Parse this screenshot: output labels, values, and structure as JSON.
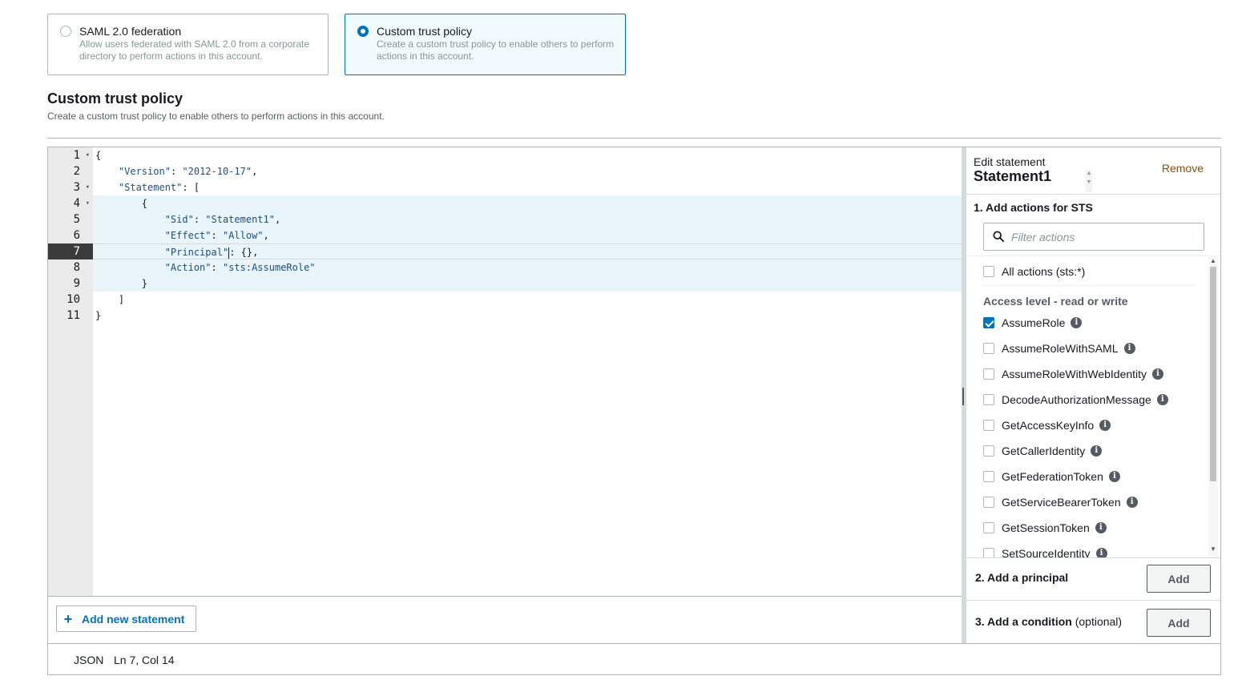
{
  "trust_options": [
    {
      "title": "SAML 2.0 federation",
      "desc": "Allow users federated with SAML 2.0 from a corporate directory to perform actions in this account.",
      "selected": false
    },
    {
      "title": "Custom trust policy",
      "desc": "Create a custom trust policy to enable others to perform actions in this account.",
      "selected": true
    }
  ],
  "section": {
    "title": "Custom trust policy",
    "desc": "Create a custom trust policy to enable others to perform actions in this account."
  },
  "editor": {
    "line_numbers": [
      "1",
      "2",
      "3",
      "4",
      "5",
      "6",
      "7",
      "8",
      "9",
      "10",
      "11"
    ],
    "active_line": 7,
    "lines": [
      "{",
      "    \"Version\": \"2012-10-17\",",
      "    \"Statement\": [",
      "        {",
      "            \"Sid\": \"Statement1\",",
      "            \"Effect\": \"Allow\",",
      "            \"Principal\": {},",
      "            \"Action\": \"sts:AssumeRole\"",
      "        }",
      "    ]",
      "}"
    ],
    "add_statement_label": "Add new statement"
  },
  "panel": {
    "edit_label": "Edit statement",
    "statement_name": "Statement1",
    "remove_label": "Remove",
    "step1_title": "1. Add actions for STS",
    "filter_placeholder": "Filter actions",
    "all_actions_label": "All actions (sts:*)",
    "access_level_label": "Access level - read or write",
    "actions": [
      {
        "name": "AssumeRole",
        "checked": true
      },
      {
        "name": "AssumeRoleWithSAML",
        "checked": false
      },
      {
        "name": "AssumeRoleWithWebIdentity",
        "checked": false
      },
      {
        "name": "DecodeAuthorizationMessage",
        "checked": false
      },
      {
        "name": "GetAccessKeyInfo",
        "checked": false
      },
      {
        "name": "GetCallerIdentity",
        "checked": false
      },
      {
        "name": "GetFederationToken",
        "checked": false
      },
      {
        "name": "GetServiceBearerToken",
        "checked": false
      },
      {
        "name": "GetSessionToken",
        "checked": false
      },
      {
        "name": "SetSourceIdentity",
        "checked": false
      }
    ],
    "step2_title": "2. Add a principal",
    "step2_button": "Add",
    "step3_title": "3. Add a condition",
    "step3_optional": "(optional)",
    "step3_button": "Add"
  },
  "status_bar": {
    "language": "JSON",
    "position": "Ln 7, Col 14"
  },
  "icons": {
    "plus": "plus-icon",
    "search": "search-icon",
    "info": "info-icon",
    "fold": "fold-arrow-icon"
  },
  "colors": {
    "accent": "#0073bb",
    "remove": "#8a4b11"
  }
}
